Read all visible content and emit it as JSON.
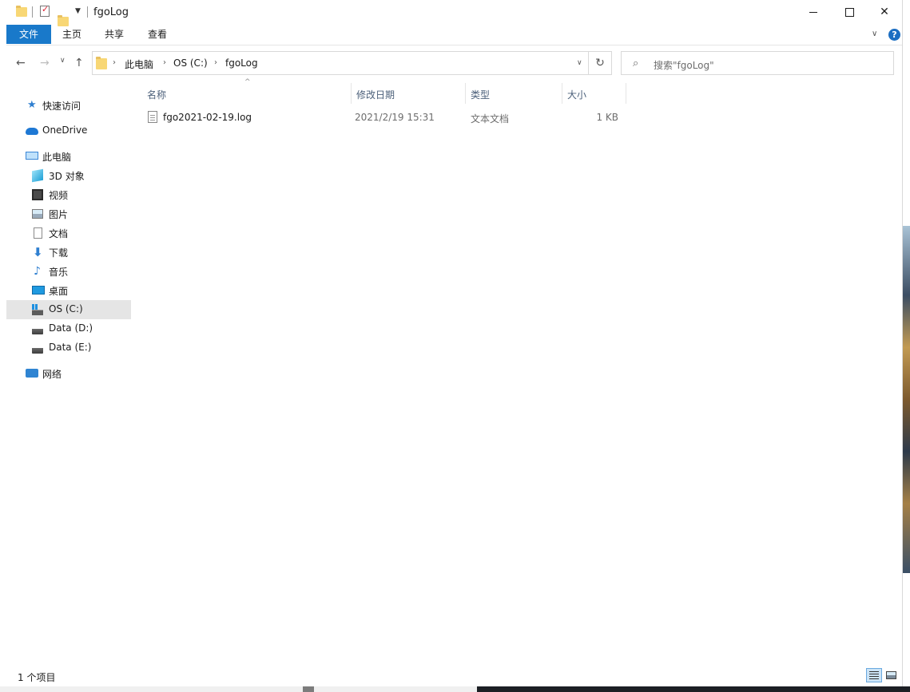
{
  "window": {
    "title": "fgoLog"
  },
  "ribbon": {
    "tabs": [
      {
        "label": "文件"
      },
      {
        "label": "主页"
      },
      {
        "label": "共享"
      },
      {
        "label": "查看"
      }
    ],
    "help_label": "?"
  },
  "address": {
    "breadcrumbs": [
      "此电脑",
      "OS (C:)",
      "fgoLog"
    ],
    "refresh_symbol": "↻"
  },
  "search": {
    "placeholder": "搜索\"fgoLog\""
  },
  "nav_pane": {
    "items": [
      {
        "label": "快速访问",
        "icon": "star-icon"
      },
      {
        "label": "OneDrive",
        "icon": "cloud-icon"
      },
      {
        "label": "此电脑",
        "icon": "computer-icon"
      },
      {
        "label": "3D 对象",
        "icon": "cube-icon"
      },
      {
        "label": "视频",
        "icon": "film-icon"
      },
      {
        "label": "图片",
        "icon": "picture-icon"
      },
      {
        "label": "文档",
        "icon": "document-icon"
      },
      {
        "label": "下载",
        "icon": "download-arrow-icon"
      },
      {
        "label": "音乐",
        "icon": "music-note-icon"
      },
      {
        "label": "桌面",
        "icon": "desktop-icon"
      },
      {
        "label": "OS (C:)",
        "icon": "windows-drive-icon",
        "selected": true
      },
      {
        "label": "Data (D:)",
        "icon": "drive-icon"
      },
      {
        "label": "Data (E:)",
        "icon": "drive-icon"
      },
      {
        "label": "网络",
        "icon": "network-icon"
      }
    ]
  },
  "file_list": {
    "columns": [
      "名称",
      "修改日期",
      "类型",
      "大小"
    ],
    "rows": [
      {
        "name": "fgo2021-02-19.log",
        "modified": "2021/2/19 15:31",
        "type": "文本文档",
        "size": "1 KB"
      }
    ]
  },
  "status_bar": {
    "item_count": "1 个项目"
  },
  "colors": {
    "file_tab_bg": "#1979ca",
    "selected_nav_bg": "#e5e5e5",
    "column_header_text": "#4c607a"
  }
}
